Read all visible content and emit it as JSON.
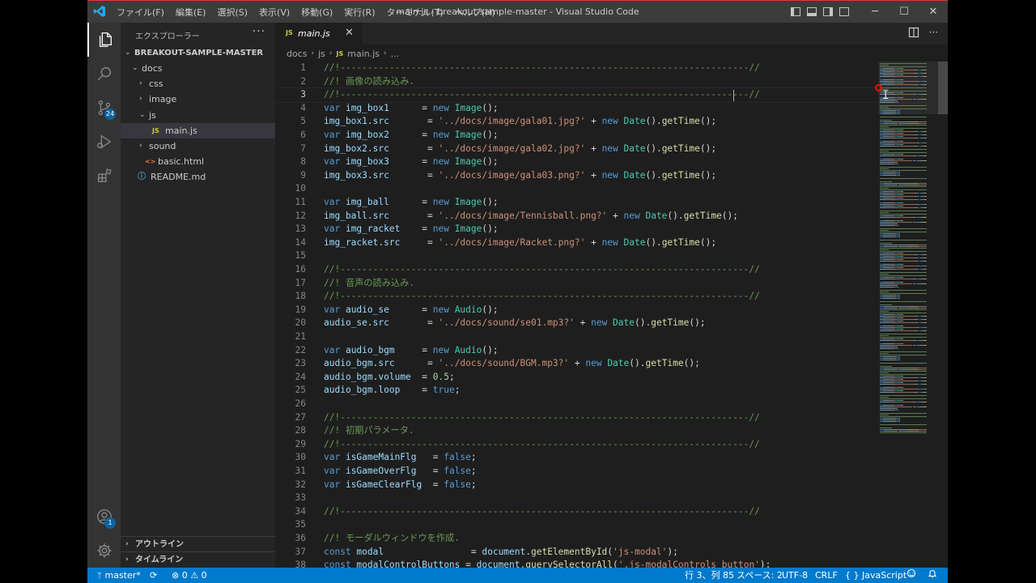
{
  "window": {
    "title": "main.js - breakout-sample-master - Visual Studio Code",
    "menu": [
      "ファイル(F)",
      "編集(E)",
      "選択(S)",
      "表示(V)",
      "移動(G)",
      "実行(R)",
      "ターミナル(T)",
      "ヘルプ(H)"
    ],
    "controls": {
      "minimize": "─",
      "maximize": "☐",
      "close": "✕"
    }
  },
  "activity_bar": {
    "items": [
      {
        "icon": "files-icon"
      },
      {
        "icon": "search-icon"
      },
      {
        "icon": "source-control-icon",
        "badge": "24"
      },
      {
        "icon": "run-debug-icon"
      },
      {
        "icon": "extensions-icon"
      }
    ],
    "accounts_badge": "1",
    "manage_icon": "gear-icon"
  },
  "sidebar": {
    "header": "エクスプローラー",
    "more": "···",
    "root": "BREAKOUT-SAMPLE-MASTER",
    "tree": [
      {
        "label": "docs",
        "type": "folder",
        "open": true,
        "depth": 1
      },
      {
        "label": "css",
        "type": "folder",
        "open": false,
        "depth": 2
      },
      {
        "label": "image",
        "type": "folder",
        "open": false,
        "depth": 2
      },
      {
        "label": "js",
        "type": "folder",
        "open": true,
        "depth": 2
      },
      {
        "label": "main.js",
        "type": "js",
        "depth": 3,
        "selected": true,
        "badge": "JS"
      },
      {
        "label": "sound",
        "type": "folder",
        "open": false,
        "depth": 2
      },
      {
        "label": "basic.html",
        "type": "html",
        "depth": 2,
        "badge": "<>"
      },
      {
        "label": "README.md",
        "type": "md",
        "depth": 1,
        "badge": "ⓘ"
      }
    ],
    "outline": "アウトライン",
    "timeline": "タイムライン"
  },
  "editor": {
    "tab": {
      "icon_text": "JS",
      "name": "main.js",
      "close": "✕"
    },
    "breadcrumb": {
      "parts": [
        "docs",
        "js",
        "main.js",
        "..."
      ],
      "icon_text": "JS"
    },
    "lines": [
      {
        "n": "1",
        "t": [
          [
            "c-com",
            "//!---------------------------------------------------------------------------//"
          ]
        ]
      },
      {
        "n": "2",
        "t": [
          [
            "c-com",
            "//! 画像の読み込み."
          ]
        ]
      },
      {
        "n": "3",
        "t": [
          [
            "c-com",
            "//!---------------------------------------------------------------------------//"
          ]
        ],
        "cur": true
      },
      {
        "n": "4",
        "t": [
          [
            "c-kw",
            "var "
          ],
          [
            "c-var",
            "img_box1"
          ],
          [
            "",
            "      = "
          ],
          [
            "c-kw",
            "new "
          ],
          [
            "c-cls",
            "Image"
          ],
          [
            "",
            "();"
          ]
        ]
      },
      {
        "n": "5",
        "t": [
          [
            "c-var",
            "img_box1"
          ],
          [
            "",
            "."
          ],
          [
            "c-var",
            "src"
          ],
          [
            "",
            "       = "
          ],
          [
            "c-str",
            "'../docs/image/gala01.jpg?'"
          ],
          [
            "",
            " + "
          ],
          [
            "c-kw",
            "new "
          ],
          [
            "c-cls",
            "Date"
          ],
          [
            "",
            "()."
          ],
          [
            "c-fn",
            "getTime"
          ],
          [
            "",
            "();"
          ]
        ]
      },
      {
        "n": "6",
        "t": [
          [
            "c-kw",
            "var "
          ],
          [
            "c-var",
            "img_box2"
          ],
          [
            "",
            "      = "
          ],
          [
            "c-kw",
            "new "
          ],
          [
            "c-cls",
            "Image"
          ],
          [
            "",
            "();"
          ]
        ]
      },
      {
        "n": "7",
        "t": [
          [
            "c-var",
            "img_box2"
          ],
          [
            "",
            "."
          ],
          [
            "c-var",
            "src"
          ],
          [
            "",
            "       = "
          ],
          [
            "c-str",
            "'../docs/image/gala02.jpg?'"
          ],
          [
            "",
            " + "
          ],
          [
            "c-kw",
            "new "
          ],
          [
            "c-cls",
            "Date"
          ],
          [
            "",
            "()."
          ],
          [
            "c-fn",
            "getTime"
          ],
          [
            "",
            "();"
          ]
        ]
      },
      {
        "n": "8",
        "t": [
          [
            "c-kw",
            "var "
          ],
          [
            "c-var",
            "img_box3"
          ],
          [
            "",
            "      = "
          ],
          [
            "c-kw",
            "new "
          ],
          [
            "c-cls",
            "Image"
          ],
          [
            "",
            "();"
          ]
        ]
      },
      {
        "n": "9",
        "t": [
          [
            "c-var",
            "img_box3"
          ],
          [
            "",
            "."
          ],
          [
            "c-var",
            "src"
          ],
          [
            "",
            "       = "
          ],
          [
            "c-str",
            "'../docs/image/gala03.png?'"
          ],
          [
            "",
            " + "
          ],
          [
            "c-kw",
            "new "
          ],
          [
            "c-cls",
            "Date"
          ],
          [
            "",
            "()."
          ],
          [
            "c-fn",
            "getTime"
          ],
          [
            "",
            "();"
          ]
        ]
      },
      {
        "n": "10",
        "t": []
      },
      {
        "n": "11",
        "t": [
          [
            "c-kw",
            "var "
          ],
          [
            "c-var",
            "img_ball"
          ],
          [
            "",
            "      = "
          ],
          [
            "c-kw",
            "new "
          ],
          [
            "c-cls",
            "Image"
          ],
          [
            "",
            "();"
          ]
        ]
      },
      {
        "n": "12",
        "t": [
          [
            "c-var",
            "img_ball"
          ],
          [
            "",
            "."
          ],
          [
            "c-var",
            "src"
          ],
          [
            "",
            "       = "
          ],
          [
            "c-str",
            "'../docs/image/Tennisball.png?'"
          ],
          [
            "",
            " + "
          ],
          [
            "c-kw",
            "new "
          ],
          [
            "c-cls",
            "Date"
          ],
          [
            "",
            "()."
          ],
          [
            "c-fn",
            "getTime"
          ],
          [
            "",
            "();"
          ]
        ]
      },
      {
        "n": "13",
        "t": [
          [
            "c-kw",
            "var "
          ],
          [
            "c-var",
            "img_racket"
          ],
          [
            "",
            "    = "
          ],
          [
            "c-kw",
            "new "
          ],
          [
            "c-cls",
            "Image"
          ],
          [
            "",
            "();"
          ]
        ]
      },
      {
        "n": "14",
        "t": [
          [
            "c-var",
            "img_racket"
          ],
          [
            "",
            "."
          ],
          [
            "c-var",
            "src"
          ],
          [
            "",
            "     = "
          ],
          [
            "c-str",
            "'../docs/image/Racket.png?'"
          ],
          [
            "",
            " + "
          ],
          [
            "c-kw",
            "new "
          ],
          [
            "c-cls",
            "Date"
          ],
          [
            "",
            "()."
          ],
          [
            "c-fn",
            "getTime"
          ],
          [
            "",
            "();"
          ]
        ]
      },
      {
        "n": "15",
        "t": []
      },
      {
        "n": "16",
        "t": [
          [
            "c-com",
            "//!---------------------------------------------------------------------------//"
          ]
        ]
      },
      {
        "n": "17",
        "t": [
          [
            "c-com",
            "//! 音声の読み込み."
          ]
        ]
      },
      {
        "n": "18",
        "t": [
          [
            "c-com",
            "//!---------------------------------------------------------------------------//"
          ]
        ]
      },
      {
        "n": "19",
        "t": [
          [
            "c-kw",
            "var "
          ],
          [
            "c-var",
            "audio_se"
          ],
          [
            "",
            "      = "
          ],
          [
            "c-kw",
            "new "
          ],
          [
            "c-cls",
            "Audio"
          ],
          [
            "",
            "();"
          ]
        ]
      },
      {
        "n": "20",
        "t": [
          [
            "c-var",
            "audio_se"
          ],
          [
            "",
            "."
          ],
          [
            "c-var",
            "src"
          ],
          [
            "",
            "       = "
          ],
          [
            "c-str",
            "'../docs/sound/se01.mp3?'"
          ],
          [
            "",
            " + "
          ],
          [
            "c-kw",
            "new "
          ],
          [
            "c-cls",
            "Date"
          ],
          [
            "",
            "()."
          ],
          [
            "c-fn",
            "getTime"
          ],
          [
            "",
            "();"
          ]
        ]
      },
      {
        "n": "21",
        "t": []
      },
      {
        "n": "22",
        "t": [
          [
            "c-kw",
            "var "
          ],
          [
            "c-var",
            "audio_bgm"
          ],
          [
            "",
            "     = "
          ],
          [
            "c-kw",
            "new "
          ],
          [
            "c-cls",
            "Audio"
          ],
          [
            "",
            "();"
          ]
        ]
      },
      {
        "n": "23",
        "t": [
          [
            "c-var",
            "audio_bgm"
          ],
          [
            "",
            "."
          ],
          [
            "c-var",
            "src"
          ],
          [
            "",
            "      = "
          ],
          [
            "c-str",
            "'../docs/sound/BGM.mp3?'"
          ],
          [
            "",
            " + "
          ],
          [
            "c-kw",
            "new "
          ],
          [
            "c-cls",
            "Date"
          ],
          [
            "",
            "()."
          ],
          [
            "c-fn",
            "getTime"
          ],
          [
            "",
            "();"
          ]
        ]
      },
      {
        "n": "24",
        "t": [
          [
            "c-var",
            "audio_bgm"
          ],
          [
            "",
            "."
          ],
          [
            "c-var",
            "volume"
          ],
          [
            "",
            "  = "
          ],
          [
            "c-num",
            "0.5"
          ],
          [
            "",
            ";"
          ]
        ]
      },
      {
        "n": "25",
        "t": [
          [
            "c-var",
            "audio_bgm"
          ],
          [
            "",
            "."
          ],
          [
            "c-var",
            "loop"
          ],
          [
            "",
            "    = "
          ],
          [
            "c-kw",
            "true"
          ],
          [
            "",
            ";"
          ]
        ]
      },
      {
        "n": "26",
        "t": []
      },
      {
        "n": "27",
        "t": [
          [
            "c-com",
            "//!---------------------------------------------------------------------------//"
          ]
        ]
      },
      {
        "n": "28",
        "t": [
          [
            "c-com",
            "//! 初期パラメータ."
          ]
        ]
      },
      {
        "n": "29",
        "t": [
          [
            "c-com",
            "//!---------------------------------------------------------------------------//"
          ]
        ]
      },
      {
        "n": "30",
        "t": [
          [
            "c-kw",
            "var "
          ],
          [
            "c-var",
            "isGameMainFlg"
          ],
          [
            "",
            "   = "
          ],
          [
            "c-kw",
            "false"
          ],
          [
            "",
            ";"
          ]
        ]
      },
      {
        "n": "31",
        "t": [
          [
            "c-kw",
            "var "
          ],
          [
            "c-var",
            "isGameOverFlg"
          ],
          [
            "",
            "   = "
          ],
          [
            "c-kw",
            "false"
          ],
          [
            "",
            ";"
          ]
        ]
      },
      {
        "n": "32",
        "t": [
          [
            "c-kw",
            "var "
          ],
          [
            "c-var",
            "isGameClearFlg"
          ],
          [
            "",
            "  = "
          ],
          [
            "c-kw",
            "false"
          ],
          [
            "",
            ";"
          ]
        ]
      },
      {
        "n": "33",
        "t": []
      },
      {
        "n": "34",
        "t": [
          [
            "c-com",
            "//!---------------------------------------------------------------------------//"
          ]
        ]
      },
      {
        "n": "35",
        "t": []
      },
      {
        "n": "36",
        "t": [
          [
            "c-com",
            "//! モーダルウィンドウを作成."
          ]
        ]
      },
      {
        "n": "37",
        "t": [
          [
            "c-kw",
            "const "
          ],
          [
            "c-var",
            "modal"
          ],
          [
            "",
            "                = "
          ],
          [
            "c-var",
            "document"
          ],
          [
            "",
            "."
          ],
          [
            "c-fn",
            "getElementById"
          ],
          [
            "",
            "("
          ],
          [
            "c-str",
            "'js-modal'"
          ],
          [
            "",
            ");"
          ]
        ]
      },
      {
        "n": "38",
        "t": [
          [
            "c-kw",
            "const "
          ],
          [
            "c-var",
            "modalControlButtons"
          ],
          [
            "",
            " = "
          ],
          [
            "c-var",
            "document"
          ],
          [
            "",
            "."
          ],
          [
            "c-fn",
            "querySelectorAll"
          ],
          [
            "",
            "("
          ],
          [
            "c-str",
            "'.js-modalControls button'"
          ],
          [
            "",
            ");"
          ]
        ]
      }
    ]
  },
  "statusbar": {
    "branch": "master*",
    "sync": "⟳",
    "problems": "⊗ 0  ⚠ 0",
    "position": "行 3、列 85",
    "spaces": "スペース: 2",
    "encoding": "UTF-8",
    "eol": "CRLF",
    "language": "JavaScript",
    "language_icon": "{ }"
  },
  "colors": {
    "accent": "#007acc",
    "comment": "#6a9955",
    "keyword": "#569cd6",
    "string": "#ce9178",
    "class": "#4ec9b0",
    "function": "#dcdcaa"
  }
}
